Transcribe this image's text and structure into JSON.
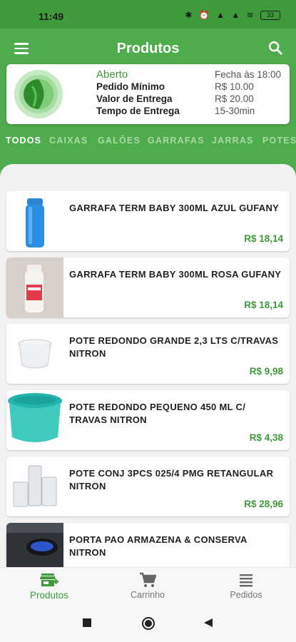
{
  "status_bar": {
    "time": "11:49",
    "icons": "✱ ⏰ ▲ ▲ ≋",
    "battery": "33"
  },
  "app_bar": {
    "title": "Produtos"
  },
  "store": {
    "status": "Aberto",
    "closing": "Fecha às 18:00",
    "labels": [
      "Pedido Mínimo",
      "Valor de Entrega",
      "Tempo de Entrega"
    ],
    "values": [
      "R$ 10.00",
      "R$ 20.00",
      "15-30min"
    ]
  },
  "tabs": [
    "TODOS",
    "CAIXAS",
    "GALÕES",
    "GARRAFAS",
    "JARRAS",
    "POTES"
  ],
  "products": [
    {
      "name": "GARRAFA TERM BABY 300ML AZUL GUFANY",
      "price": "R$ 18,14"
    },
    {
      "name": "GARRAFA TERM BABY 300ML ROSA GUFANY",
      "price": "R$ 18,14"
    },
    {
      "name": "POTE REDONDO GRANDE 2,3 LTS C/TRAVAS NITRON",
      "price": "R$ 9,98"
    },
    {
      "name": "POTE REDONDO PEQUENO 450 ML C/ TRAVAS NITRON",
      "price": "R$ 4,38"
    },
    {
      "name": "POTE CONJ 3PCS 025/4 PMG RETANGULAR NITRON",
      "price": "R$ 28,96"
    },
    {
      "name": "PORTA PAO ARMAZENA & CONSERVA NITRON",
      "price": ""
    }
  ],
  "bottom_nav": [
    {
      "label": "Produtos",
      "icon": "store-icon"
    },
    {
      "label": "Carrinho",
      "icon": "cart-icon"
    },
    {
      "label": "Pedidos",
      "icon": "list-icon"
    }
  ],
  "colors": {
    "primary": "#4fac4c",
    "price": "#3f9a3c"
  }
}
